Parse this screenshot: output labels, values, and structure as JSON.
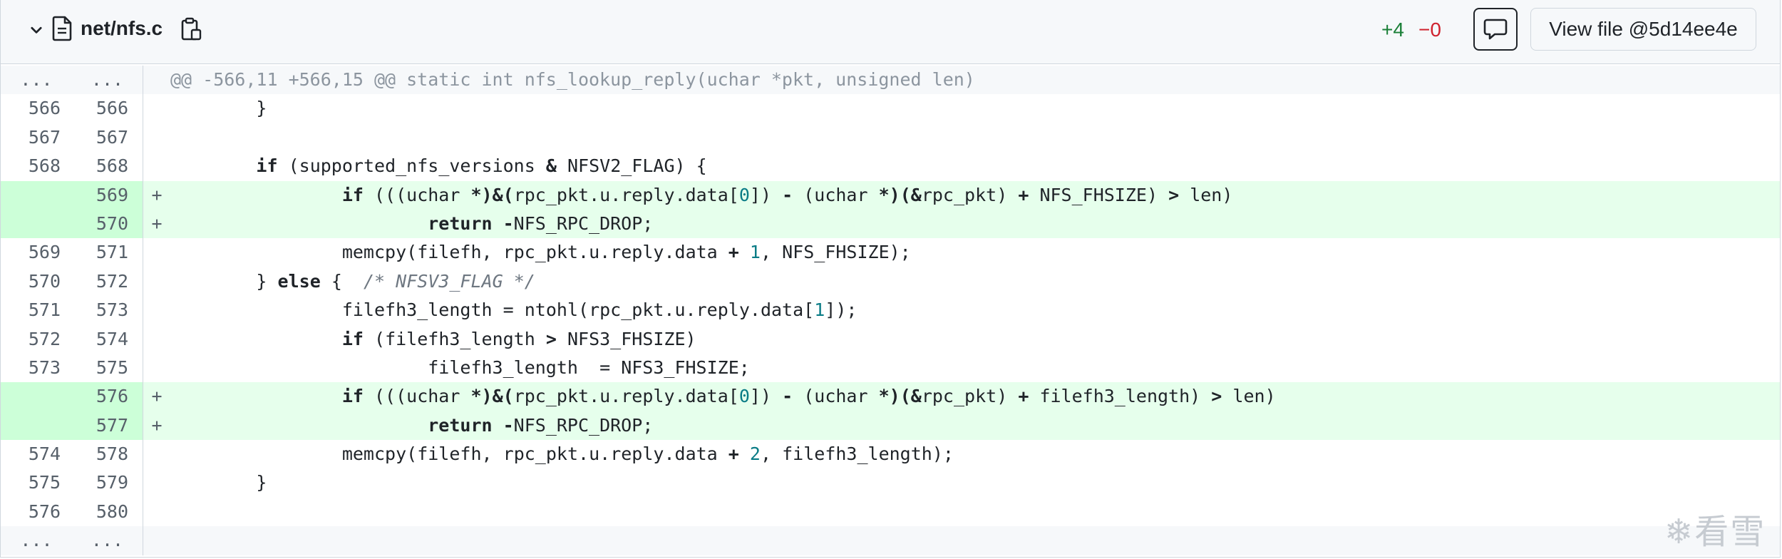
{
  "file": {
    "name": "net/nfs.c",
    "additions": "+4",
    "deletions": "−0",
    "view_file_label": "View file @5d14ee4e"
  },
  "icons": {
    "collapse": "chevron-down-icon",
    "file": "file-icon",
    "copy": "copy-icon",
    "comment": "comment-icon"
  },
  "colors": {
    "addition_bg": "#e6ffec",
    "addition_num_bg": "#ccffd8",
    "addition_text": "#1a7f37",
    "deletion_text": "#cf222e",
    "hunk_bg": "#f6f8fa"
  },
  "diff": {
    "hunk_header": "@@ -566,11 +566,15 @@ static int nfs_lookup_reply(uchar *pkt, unsigned len)",
    "ellipsis": "...",
    "add_marker": "+",
    "lines": [
      {
        "old": "566",
        "new": "566",
        "type": "ctx",
        "code": "        }"
      },
      {
        "old": "567",
        "new": "567",
        "type": "ctx",
        "code": ""
      },
      {
        "old": "568",
        "new": "568",
        "type": "ctx",
        "code": "        if (supported_nfs_versions & NFSV2_FLAG) {"
      },
      {
        "old": "",
        "new": "569",
        "type": "add",
        "code": "                if (((uchar *)&(rpc_pkt.u.reply.data[0]) - (uchar *)(&rpc_pkt) + NFS_FHSIZE) > len)"
      },
      {
        "old": "",
        "new": "570",
        "type": "add",
        "code": "                        return -NFS_RPC_DROP;"
      },
      {
        "old": "569",
        "new": "571",
        "type": "ctx",
        "code": "                memcpy(filefh, rpc_pkt.u.reply.data + 1, NFS_FHSIZE);"
      },
      {
        "old": "570",
        "new": "572",
        "type": "ctx",
        "code": "        } else {  /* NFSV3_FLAG */"
      },
      {
        "old": "571",
        "new": "573",
        "type": "ctx",
        "code": "                filefh3_length = ntohl(rpc_pkt.u.reply.data[1]);"
      },
      {
        "old": "572",
        "new": "574",
        "type": "ctx",
        "code": "                if (filefh3_length > NFS3_FHSIZE)"
      },
      {
        "old": "573",
        "new": "575",
        "type": "ctx",
        "code": "                        filefh3_length  = NFS3_FHSIZE;"
      },
      {
        "old": "",
        "new": "576",
        "type": "add",
        "code": "                if (((uchar *)&(rpc_pkt.u.reply.data[0]) - (uchar *)(&rpc_pkt) + filefh3_length) > len)"
      },
      {
        "old": "",
        "new": "577",
        "type": "add",
        "code": "                        return -NFS_RPC_DROP;"
      },
      {
        "old": "574",
        "new": "578",
        "type": "ctx",
        "code": "                memcpy(filefh, rpc_pkt.u.reply.data + 2, filefh3_length);"
      },
      {
        "old": "575",
        "new": "579",
        "type": "ctx",
        "code": "        }"
      },
      {
        "old": "576",
        "new": "580",
        "type": "ctx",
        "code": ""
      }
    ]
  },
  "watermark": "❄看雪"
}
